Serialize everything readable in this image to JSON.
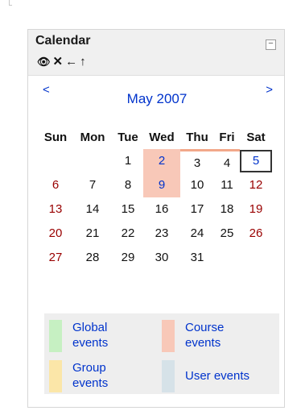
{
  "block": {
    "title": "Calendar",
    "collapse_symbol": "−",
    "icons": [
      "eye-icon",
      "close-icon",
      "left-arrow-icon",
      "up-arrow-icon"
    ]
  },
  "calendar": {
    "prev": "<",
    "next": ">",
    "month": "May 2007",
    "weekdays": [
      "Sun",
      "Mon",
      "Tue",
      "Wed",
      "Thu",
      "Fri",
      "Sat"
    ],
    "weeks": [
      [
        "",
        "",
        "1",
        "2",
        "3",
        "4",
        "5"
      ],
      [
        "6",
        "7",
        "8",
        "9",
        "10",
        "11",
        "12"
      ],
      [
        "13",
        "14",
        "15",
        "16",
        "17",
        "18",
        "19"
      ],
      [
        "20",
        "21",
        "22",
        "23",
        "24",
        "25",
        "26"
      ],
      [
        "27",
        "28",
        "29",
        "30",
        "31",
        "",
        ""
      ]
    ],
    "course_event_days": [
      "2",
      "9"
    ],
    "course_span_days": [
      "3",
      "4"
    ],
    "today": "5"
  },
  "legend": {
    "global": "Global events",
    "course": "Course events",
    "group": "Group events",
    "user": "User events"
  },
  "colors": {
    "global": "#c6f0c2",
    "course": "#f8c8b8",
    "group": "#fbe6a8",
    "user": "#d6e2e8",
    "link": "#0033cc",
    "weekend": "#990000"
  }
}
